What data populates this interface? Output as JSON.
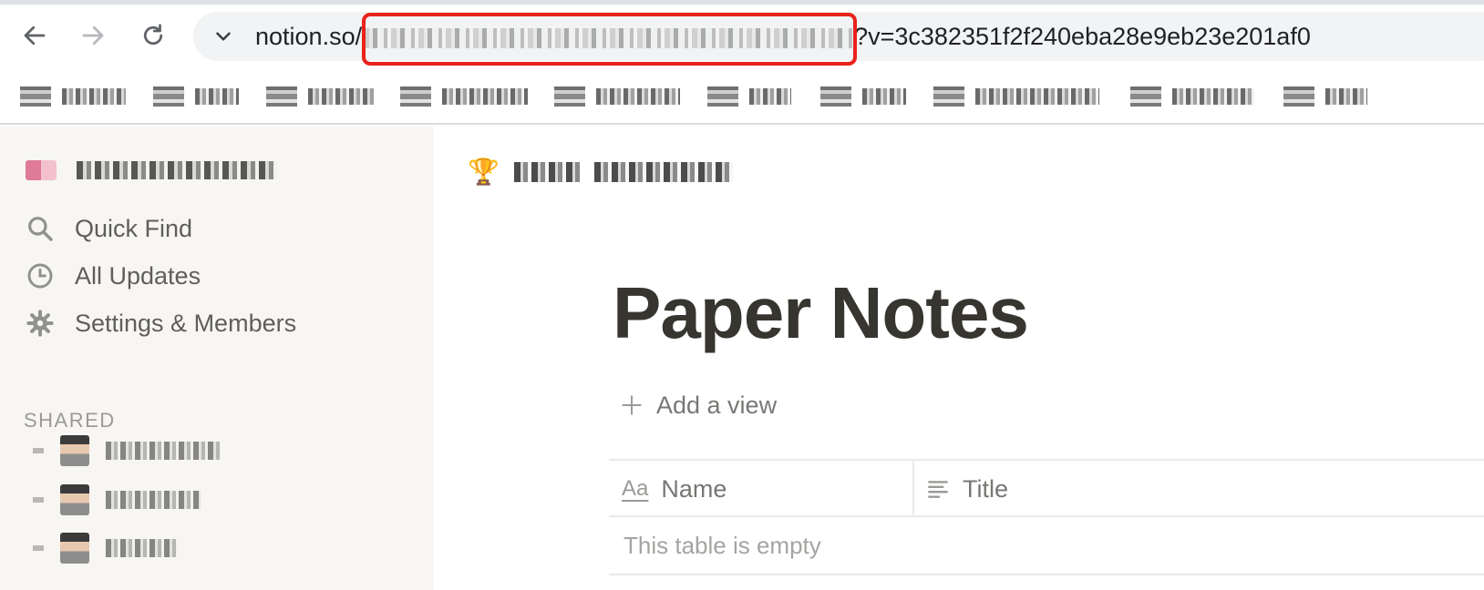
{
  "browser": {
    "url_prefix": "notion.so/",
    "url_suffix": "?v=3c382351f2f240eba28e9eb23e201af0",
    "highlight_color": "#e8231b",
    "icons": [
      "back-arrow-icon",
      "forward-arrow-icon",
      "reload-icon",
      "chevron-down-icon"
    ]
  },
  "sidebar": {
    "items": [
      {
        "label": "Quick Find",
        "icon": "search-icon"
      },
      {
        "label": "All Updates",
        "icon": "clock-icon"
      },
      {
        "label": "Settings & Members",
        "icon": "gear-icon"
      }
    ],
    "section_label": "SHARED"
  },
  "main": {
    "breadcrumb_icon": "🏆",
    "page_title": "Paper Notes",
    "add_view_label": "Add a view",
    "table": {
      "columns": [
        {
          "label": "Name",
          "icon": "Aa"
        },
        {
          "label": "Title",
          "icon": "text-lines-icon"
        }
      ],
      "empty_message": "This table is empty"
    }
  },
  "colors": {
    "sidebar_bg": "#f7f6f3",
    "text_primary": "#37352f",
    "text_secondary": "#787774"
  }
}
